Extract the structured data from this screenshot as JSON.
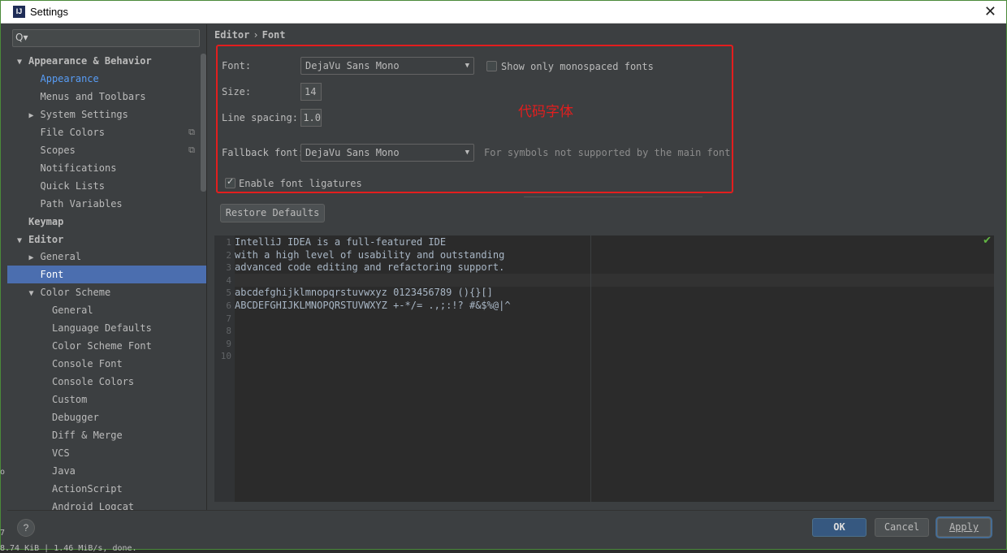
{
  "window": {
    "title": "Settings",
    "app_icon_glyph": "IJ",
    "close_glyph": "✕"
  },
  "search": {
    "icon": "search-icon",
    "glyph": "Q▾",
    "value": ""
  },
  "sidebar": {
    "items": [
      {
        "label": "Appearance & Behavior",
        "arrow": "▼",
        "level": 0,
        "bold": true
      },
      {
        "label": "Appearance",
        "arrow": "",
        "level": 1,
        "link": true
      },
      {
        "label": "Menus and Toolbars",
        "arrow": "",
        "level": 1
      },
      {
        "label": "System Settings",
        "arrow": "▶",
        "level": 1
      },
      {
        "label": "File Colors",
        "arrow": "",
        "level": 1,
        "copy_icon": true
      },
      {
        "label": "Scopes",
        "arrow": "",
        "level": 1,
        "copy_icon": true
      },
      {
        "label": "Notifications",
        "arrow": "",
        "level": 1
      },
      {
        "label": "Quick Lists",
        "arrow": "",
        "level": 1
      },
      {
        "label": "Path Variables",
        "arrow": "",
        "level": 1
      },
      {
        "label": "Keymap",
        "arrow": "",
        "level": 0,
        "bold": true
      },
      {
        "label": "Editor",
        "arrow": "▼",
        "level": 0,
        "bold": true
      },
      {
        "label": "General",
        "arrow": "▶",
        "level": 1
      },
      {
        "label": "Font",
        "arrow": "",
        "level": 1,
        "selected": true
      },
      {
        "label": "Color Scheme",
        "arrow": "▼",
        "level": 1
      },
      {
        "label": "General",
        "arrow": "",
        "level": 2
      },
      {
        "label": "Language Defaults",
        "arrow": "",
        "level": 2
      },
      {
        "label": "Color Scheme Font",
        "arrow": "",
        "level": 2
      },
      {
        "label": "Console Font",
        "arrow": "",
        "level": 2
      },
      {
        "label": "Console Colors",
        "arrow": "",
        "level": 2
      },
      {
        "label": "Custom",
        "arrow": "",
        "level": 2
      },
      {
        "label": "Debugger",
        "arrow": "",
        "level": 2
      },
      {
        "label": "Diff & Merge",
        "arrow": "",
        "level": 2
      },
      {
        "label": "VCS",
        "arrow": "",
        "level": 2
      },
      {
        "label": "Java",
        "arrow": "",
        "level": 2
      },
      {
        "label": "ActionScript",
        "arrow": "",
        "level": 2
      },
      {
        "label": "Android Logcat",
        "arrow": "",
        "level": 2
      }
    ]
  },
  "breadcrumb": {
    "parent": "Editor",
    "separator": "›",
    "current": "Font"
  },
  "font_settings": {
    "font_label": "Font:",
    "font_value": "DejaVu Sans Mono",
    "monospaced_label": "Show only monospaced fonts",
    "monospaced_checked": false,
    "size_label": "Size:",
    "size_value": "14",
    "line_spacing_label": "Line spacing:",
    "line_spacing_value": "1.0",
    "fallback_label": "Fallback font:",
    "fallback_value": "DejaVu Sans Mono",
    "fallback_hint": "For symbols not supported by the main font",
    "ligatures_label": "Enable font ligatures",
    "ligatures_checked": true,
    "annotation": "代码字体",
    "highlight_color": "#e31e1e"
  },
  "restore_defaults_label": "Restore Defaults",
  "preview": {
    "line_numbers": [
      "1",
      "2",
      "3",
      "4",
      "5",
      "6",
      "7",
      "8",
      "9",
      "10"
    ],
    "lines": [
      "IntelliJ IDEA is a full-featured IDE",
      "with a high level of usability and outstanding",
      "advanced code editing and refactoring support.",
      "",
      "abcdefghijklmnopqrstuvwxyz 0123456789 (){}[]",
      "ABCDEFGHIJKLMNOPQRSTUVWXYZ +-*/= .,;:!? #&$%@|^",
      "",
      "",
      "",
      ""
    ],
    "status_icon": "checkmark-icon",
    "status_glyph": "✔"
  },
  "buttons": {
    "help": "?",
    "ok": "OK",
    "cancel": "Cancel",
    "apply": "Apply"
  },
  "background_text": {
    "status": "8.74 KiB | 1.46 MiB/s, done.",
    "left_7": "7",
    "left_o": "o"
  },
  "colors": {
    "accent_selection": "#4b6eaf",
    "link": "#589df6",
    "ok_button": "#365880",
    "success": "#62b543"
  }
}
